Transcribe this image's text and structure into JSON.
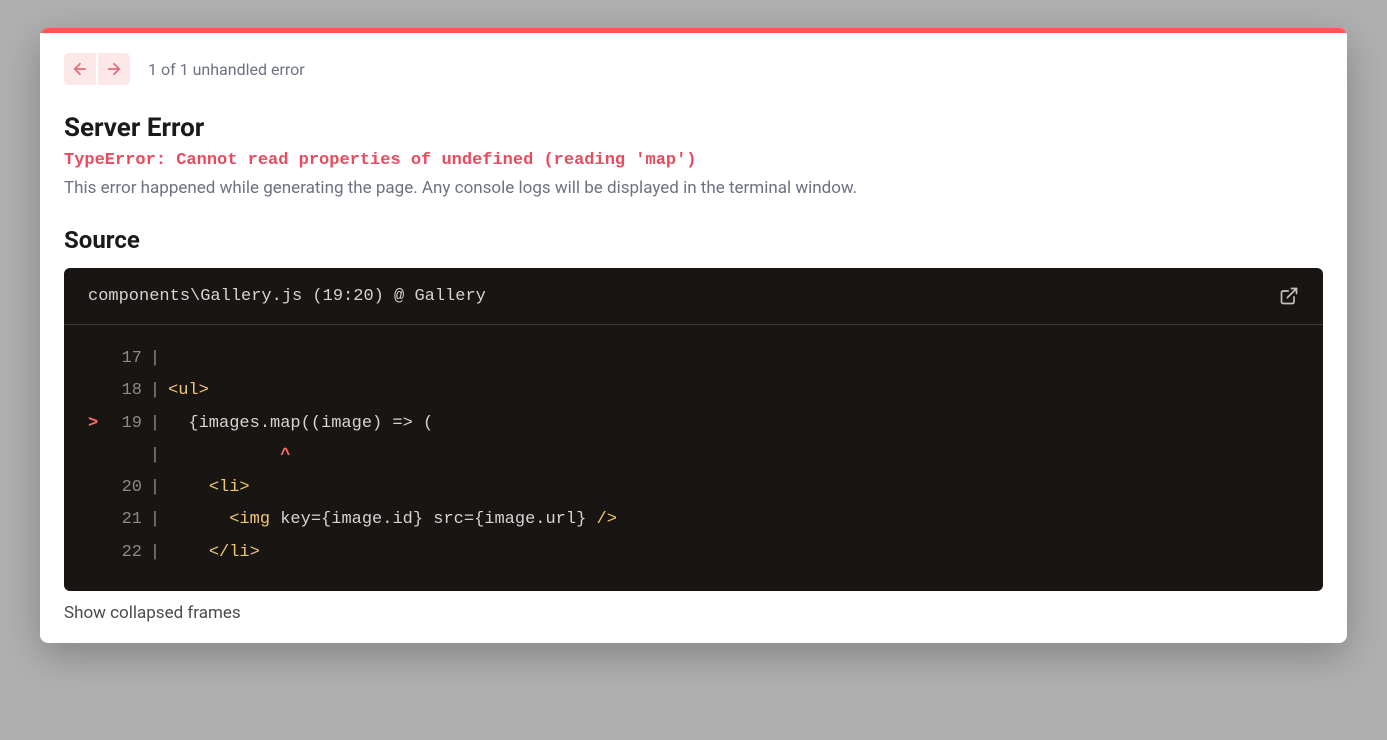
{
  "nav": {
    "status": "1 of 1 unhandled error"
  },
  "error": {
    "title": "Server Error",
    "message": "TypeError: Cannot read properties of undefined (reading 'map')",
    "hint": "This error happened while generating the page. Any console logs will be displayed in the terminal window."
  },
  "source": {
    "title": "Source",
    "location": "components\\Gallery.js (19:20) @ Gallery",
    "lines": [
      {
        "num": "17",
        "marker": "",
        "tokens": []
      },
      {
        "num": "18",
        "marker": "",
        "tokens": [
          {
            "t": "<ul>",
            "c": "tok-tag"
          }
        ]
      },
      {
        "num": "19",
        "marker": ">",
        "tokens": [
          {
            "t": "  {images.map((image) => (",
            "c": ""
          }
        ]
      },
      {
        "num": "",
        "marker": "",
        "tokens": [
          {
            "t": "           ",
            "c": ""
          },
          {
            "t": "^",
            "c": "tok-caret"
          }
        ]
      },
      {
        "num": "20",
        "marker": "",
        "tokens": [
          {
            "t": "    ",
            "c": ""
          },
          {
            "t": "<li>",
            "c": "tok-tag"
          }
        ]
      },
      {
        "num": "21",
        "marker": "",
        "tokens": [
          {
            "t": "      ",
            "c": ""
          },
          {
            "t": "<img ",
            "c": "tok-tag"
          },
          {
            "t": "key={image.id} src={image.url} ",
            "c": "tok-attr"
          },
          {
            "t": "/>",
            "c": "tok-tag"
          }
        ]
      },
      {
        "num": "22",
        "marker": "",
        "tokens": [
          {
            "t": "    ",
            "c": ""
          },
          {
            "t": "</li>",
            "c": "tok-tag"
          }
        ]
      }
    ]
  },
  "frames": {
    "toggle_label": "Show collapsed frames"
  }
}
